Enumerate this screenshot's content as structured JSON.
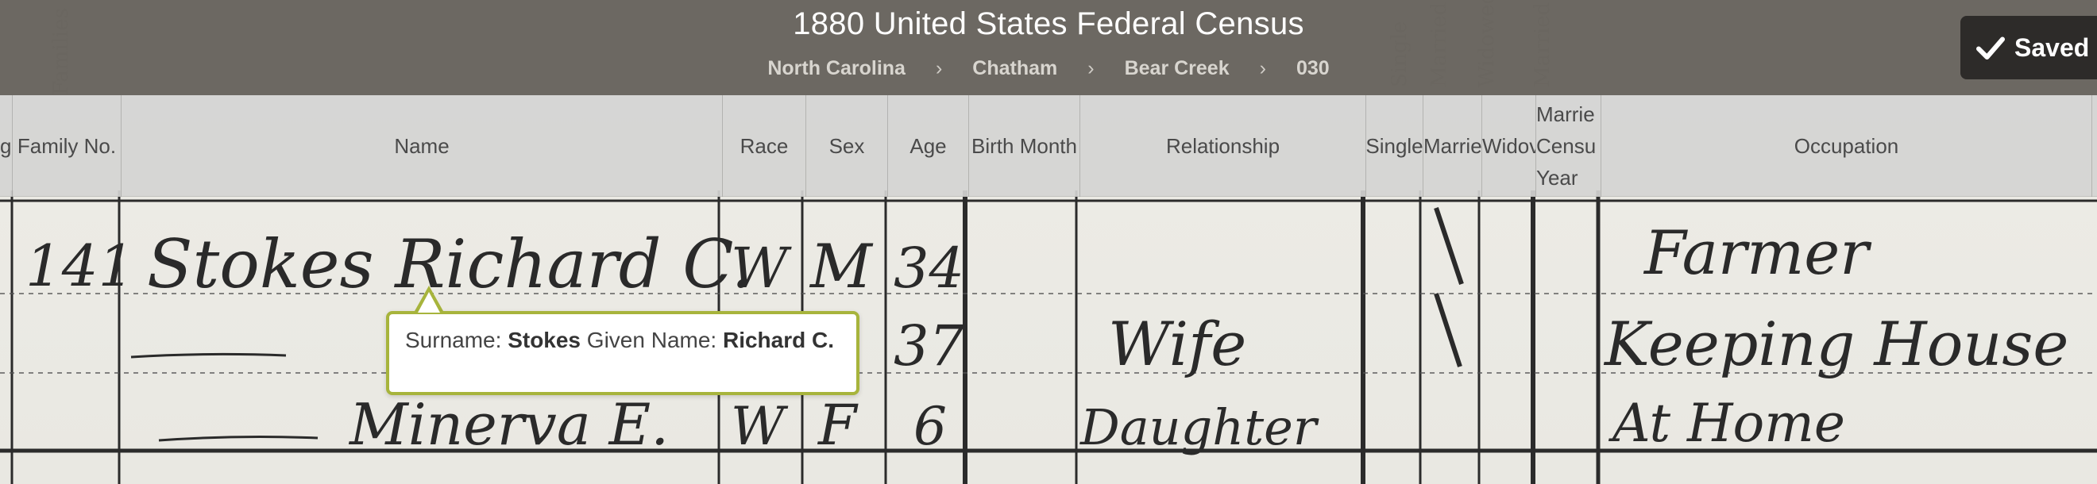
{
  "header": {
    "title": "1880 United States Federal Census",
    "breadcrumb": [
      "North Carolina",
      "Chatham",
      "Bear Creek",
      "030"
    ],
    "saved_label": "Saved"
  },
  "columns": [
    {
      "key": "dwelling",
      "label": "g"
    },
    {
      "key": "family_no",
      "label": "Family No."
    },
    {
      "key": "name",
      "label": "Name"
    },
    {
      "key": "race",
      "label": "Race"
    },
    {
      "key": "sex",
      "label": "Sex"
    },
    {
      "key": "age",
      "label": "Age"
    },
    {
      "key": "birth_month",
      "label": "Birth Month"
    },
    {
      "key": "relationship",
      "label": "Relationship"
    },
    {
      "key": "single",
      "label": "Single"
    },
    {
      "key": "married",
      "label": "Marrie"
    },
    {
      "key": "widowed",
      "label": "Widov"
    },
    {
      "key": "married_census_year",
      "label": "Marrie Censu Year"
    },
    {
      "key": "occupation",
      "label": "Occupation"
    }
  ],
  "tooltip": {
    "surname_label": "Surname:",
    "surname": "Stokes",
    "given_label": "Given Name:",
    "given": "Richard C."
  },
  "scan_rows": [
    {
      "family_no": "141",
      "name": "Stokes Richard C.",
      "race": "W",
      "sex": "M",
      "age": "34",
      "relationship": "",
      "married_mark": "\\",
      "occupation": "Farmer"
    },
    {
      "family_no": "",
      "name": "",
      "race": "",
      "sex": "",
      "age": "37",
      "relationship": "Wife",
      "married_mark": "\\",
      "occupation": "Keeping House"
    },
    {
      "family_no": "",
      "name": "Minerva E.",
      "race": "W",
      "sex": "F",
      "age": "6",
      "relationship": "Daughter",
      "married_mark": "",
      "occupation": "At Home"
    }
  ]
}
